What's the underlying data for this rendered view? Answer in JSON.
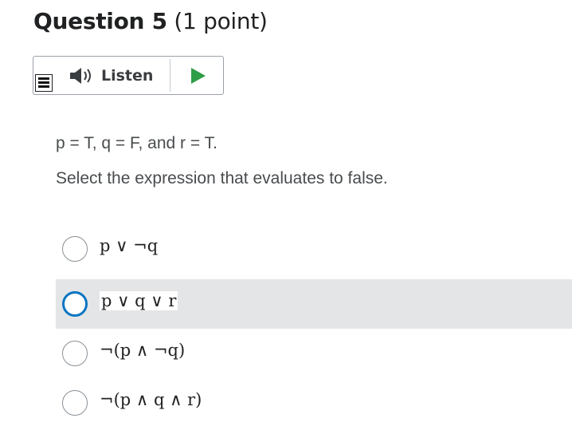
{
  "question": {
    "label": "Question 5",
    "points": "(1 point)"
  },
  "listen": {
    "label": "Listen",
    "icons": {
      "menu": "menu-icon",
      "speaker": "speaker-icon",
      "play": "play-icon"
    },
    "play_color": "#2e9e47"
  },
  "body": {
    "given": "p = T, q = F, and r = T.",
    "prompt": "Select the expression that evaluates to false."
  },
  "options": [
    {
      "expression": "p ∨ ¬q",
      "highlighted": false
    },
    {
      "expression": "p ∨ q ∨ r",
      "highlighted": true
    },
    {
      "expression": "¬(p ∧ ¬q)",
      "highlighted": false
    },
    {
      "expression": "¬(p ∧ q ∧ r)",
      "highlighted": false
    }
  ],
  "colors": {
    "focus_ring": "#0a75c2",
    "highlight_bg": "#e3e5e7"
  }
}
